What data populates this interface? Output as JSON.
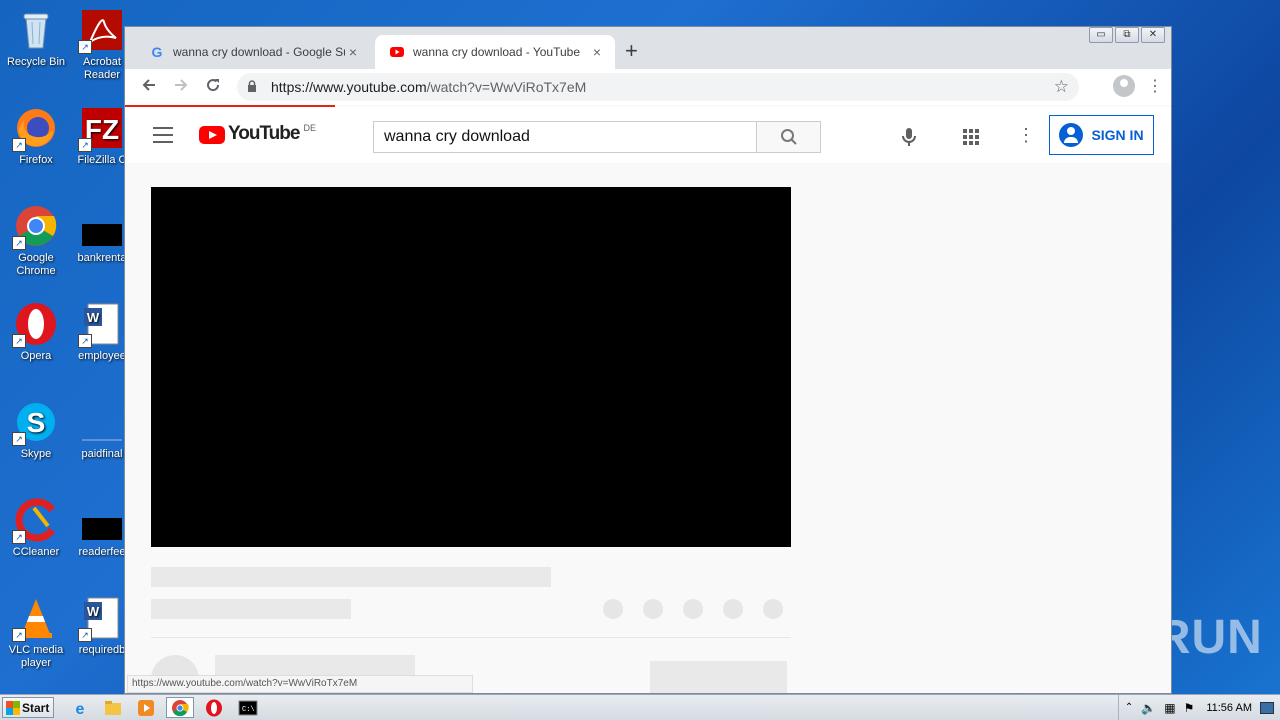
{
  "desktop": {
    "icons_left": [
      {
        "label": "Recycle Bin",
        "icon": "recycle-bin-icon"
      },
      {
        "label": "Firefox",
        "icon": "firefox-icon"
      },
      {
        "label": "Google Chrome",
        "icon": "chrome-icon"
      },
      {
        "label": "Opera",
        "icon": "opera-icon"
      },
      {
        "label": "Skype",
        "icon": "skype-icon"
      },
      {
        "label": "CCleaner",
        "icon": "ccleaner-icon"
      },
      {
        "label": "VLC media player",
        "icon": "vlc-icon"
      }
    ],
    "icons_right": [
      {
        "label": "Acrobat Reader",
        "icon": "acrobat-icon"
      },
      {
        "label": "FileZilla C",
        "icon": "filezilla-icon"
      },
      {
        "label": "bankrenta",
        "icon": "file-icon"
      },
      {
        "label": "employee",
        "icon": "word-doc-icon"
      },
      {
        "label": "paidfinal",
        "icon": "file-icon"
      },
      {
        "label": "readerfee",
        "icon": "file-icon"
      },
      {
        "label": "requiredb",
        "icon": "word-doc-icon"
      }
    ],
    "watermark": "ANY RUN"
  },
  "browser": {
    "tabs": [
      {
        "title": "wanna cry download - Google Suche",
        "close": "×"
      },
      {
        "title": "wanna cry download - YouTube",
        "close": "×"
      }
    ],
    "new_tab": "+",
    "url_host": "https://www.youtube.com",
    "url_path": "/watch?v=WwViRoTx7eM",
    "status_url": "https://www.youtube.com/watch?v=WwViRoTx7eM",
    "window_controls": [
      "▭",
      "⧉",
      "✕"
    ]
  },
  "youtube": {
    "logo_text": "YouTube",
    "region": "DE",
    "search_value": "wanna cry download",
    "sign_in": "SIGN IN"
  },
  "taskbar": {
    "start": "Start",
    "clock": "11:56 AM"
  },
  "colors": {
    "youtube_red": "#ff0000",
    "youtube_blue": "#065fd4",
    "desktop_blue": "#1565c0"
  }
}
